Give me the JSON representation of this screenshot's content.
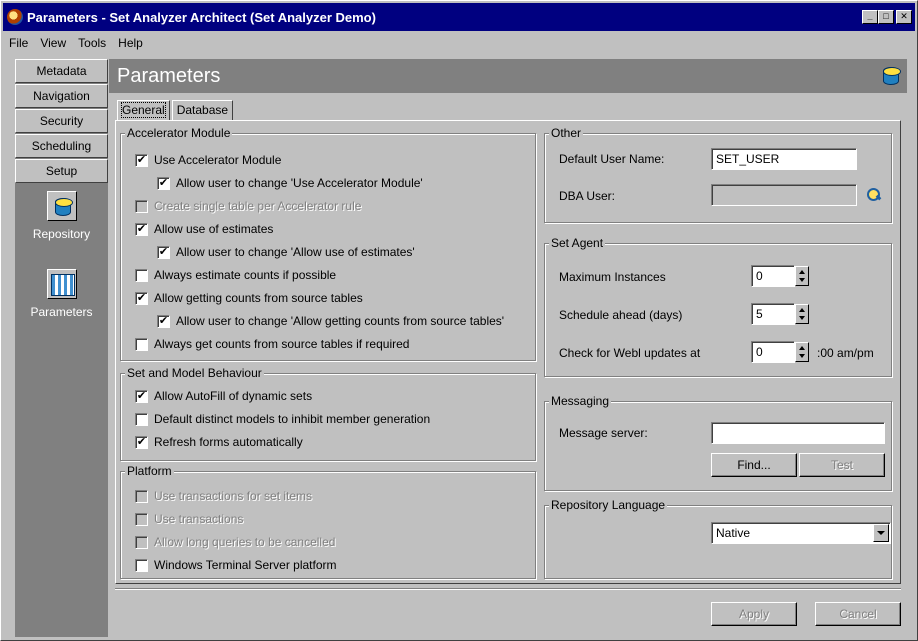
{
  "window": {
    "title": "Parameters - Set Analyzer Architect (Set Analyzer Demo)"
  },
  "menu": [
    {
      "label": "File"
    },
    {
      "label": "View"
    },
    {
      "label": "Tools"
    },
    {
      "label": "Help"
    }
  ],
  "nav": {
    "tabs": [
      "Metadata",
      "Navigation",
      "Security",
      "Scheduling",
      "Setup"
    ],
    "tiles": [
      "Repository",
      "Parameters"
    ]
  },
  "header": {
    "title": "Parameters"
  },
  "tabs": [
    "General",
    "Database"
  ],
  "accelerator": {
    "label": "Accelerator Module",
    "items": [
      {
        "label": "Use Accelerator Module",
        "checked": true,
        "enabled": true
      },
      {
        "label": "Allow user to change 'Use Accelerator Module'",
        "checked": true,
        "enabled": true
      },
      {
        "label": "Create single table per Accelerator rule",
        "checked": false,
        "enabled": false
      },
      {
        "label": "Allow use of estimates",
        "checked": true,
        "enabled": true
      },
      {
        "label": "Allow user to change 'Allow use of estimates'",
        "checked": true,
        "enabled": true
      },
      {
        "label": "Always estimate counts if possible",
        "checked": false,
        "enabled": true
      },
      {
        "label": "Allow getting counts from source tables",
        "checked": true,
        "enabled": true
      },
      {
        "label": "Allow user to change 'Allow getting counts from source tables'",
        "checked": true,
        "enabled": true
      },
      {
        "label": "Always get counts from source tables if required",
        "checked": false,
        "enabled": true
      }
    ]
  },
  "behaviour": {
    "label": "Set and Model Behaviour",
    "items": [
      {
        "label": "Allow AutoFill of dynamic sets",
        "checked": true
      },
      {
        "label": "Default distinct models to inhibit member generation",
        "checked": false
      },
      {
        "label": "Refresh forms automatically",
        "checked": true
      }
    ]
  },
  "platform": {
    "label": "Platform",
    "items": [
      {
        "label": "Use transactions for set items",
        "checked": false,
        "enabled": false
      },
      {
        "label": "Use transactions",
        "checked": false,
        "enabled": false
      },
      {
        "label": "Allow long queries to be cancelled",
        "checked": false,
        "enabled": false
      },
      {
        "label": "Windows Terminal Server platform",
        "checked": false,
        "enabled": true
      }
    ]
  },
  "other": {
    "label": "Other",
    "default_user_label": "Default User Name:",
    "default_user_value": "SET_USER",
    "dba_user_label": "DBA User:",
    "dba_user_value": ""
  },
  "set_agent": {
    "label": "Set Agent",
    "max_instances_label": "Maximum Instances",
    "max_instances_value": "0",
    "schedule_ahead_label": "Schedule ahead (days)",
    "schedule_ahead_value": "5",
    "webl_label": "Check for Webl updates at",
    "webl_value": "0",
    "webl_suffix": ":00 am/pm"
  },
  "messaging": {
    "label": "Messaging",
    "server_label": "Message server:",
    "server_value": "",
    "find_label": "Find...",
    "test_label": "Test"
  },
  "language": {
    "label": "Repository Language",
    "value": "Native"
  },
  "footer": {
    "apply_label": "Apply",
    "cancel_label": "Cancel"
  }
}
